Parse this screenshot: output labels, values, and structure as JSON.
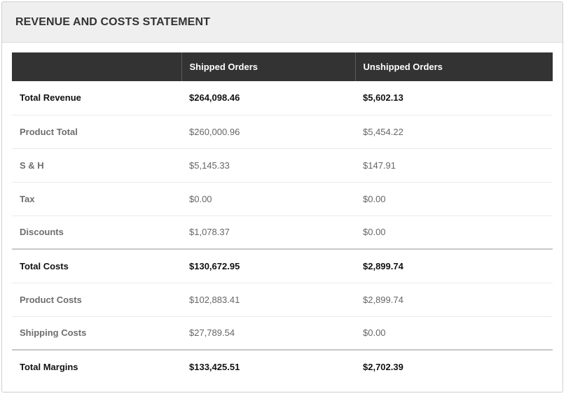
{
  "panel": {
    "title": "REVENUE AND COSTS STATEMENT"
  },
  "table": {
    "headers": [
      "",
      "Shipped Orders",
      "Unshipped Orders"
    ],
    "rows": [
      {
        "label": "Total Revenue",
        "shipped": "$264,098.46",
        "unshipped": "$5,602.13"
      },
      {
        "label": "Product Total",
        "shipped": "$260,000.96",
        "unshipped": "$5,454.22"
      },
      {
        "label": "S & H",
        "shipped": "$5,145.33",
        "unshipped": "$147.91"
      },
      {
        "label": "Tax",
        "shipped": "$0.00",
        "unshipped": "$0.00"
      },
      {
        "label": "Discounts",
        "shipped": "$1,078.37",
        "unshipped": "$0.00"
      },
      {
        "label": "Total Costs",
        "shipped": "$130,672.95",
        "unshipped": "$2,899.74"
      },
      {
        "label": "Product Costs",
        "shipped": "$102,883.41",
        "unshipped": "$2,899.74"
      },
      {
        "label": "Shipping Costs",
        "shipped": "$27,789.54",
        "unshipped": "$0.00"
      },
      {
        "label": "Total Margins",
        "shipped": "$133,425.51",
        "unshipped": "$2,702.39"
      }
    ]
  }
}
